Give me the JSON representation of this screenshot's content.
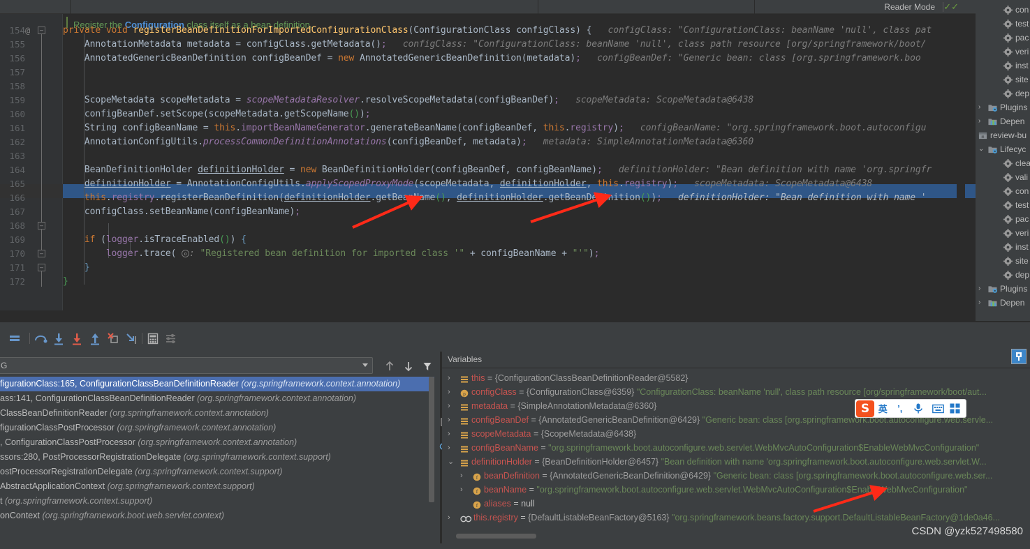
{
  "editor": {
    "reader_mode_label": "Reader Mode",
    "check_icon": "check-icon",
    "doc_comment": {
      "pre": "Register the ",
      "bold": "Configuration",
      "post": " class itself as a bean definition."
    },
    "lines": [
      {
        "num": "154",
        "gutter": "@",
        "fold": "minus"
      },
      {
        "num": "155"
      },
      {
        "num": "156"
      },
      {
        "num": "157"
      },
      {
        "num": "158"
      },
      {
        "num": "159"
      },
      {
        "num": "160"
      },
      {
        "num": "161"
      },
      {
        "num": "162"
      },
      {
        "num": "163"
      },
      {
        "num": "164"
      },
      {
        "num": "165"
      },
      {
        "num": "166"
      },
      {
        "num": "167"
      },
      {
        "num": "168",
        "fold": "minus"
      },
      {
        "num": "169"
      },
      {
        "num": "170",
        "fold": "minus"
      },
      {
        "num": "171",
        "fold": "minus"
      },
      {
        "num": "172"
      }
    ],
    "code": {
      "l154": "private void registerBeanDefinitionForImportedConfigurationClass(ConfigurationClass configClass) {",
      "l154_hint": "configClass: \"ConfigurationClass: beanName 'null', class pat",
      "l155": "AnnotationMetadata metadata = configClass.getMetadata();",
      "l155_hint": "configClass: \"ConfigurationClass: beanName 'null', class path resource [org/springframework/boot/",
      "l156": "AnnotatedGenericBeanDefinition configBeanDef = new AnnotatedGenericBeanDefinition(metadata);",
      "l156_hint": "configBeanDef: \"Generic bean: class [org.springframework.boo",
      "l158": "ScopeMetadata scopeMetadata = scopeMetadataResolver.resolveScopeMetadata(configBeanDef);",
      "l158_hint": "scopeMetadata: ScopeMetadata@6438",
      "l159": "configBeanDef.setScope(scopeMetadata.getScopeName());",
      "l160": "String configBeanName = this.importBeanNameGenerator.generateBeanName(configBeanDef, this.registry);",
      "l160_hint": "configBeanName: \"org.springframework.boot.autoconfigu",
      "l161": "AnnotationConfigUtils.processCommonDefinitionAnnotations(configBeanDef, metadata);",
      "l161_hint": "metadata: SimpleAnnotationMetadata@6360",
      "l163": "BeanDefinitionHolder definitionHolder = new BeanDefinitionHolder(configBeanDef, configBeanName);",
      "l163_hint": "definitionHolder: \"Bean definition with name 'org.springfr",
      "l164": "definitionHolder = AnnotationConfigUtils.applyScopedProxyMode(scopeMetadata, definitionHolder, this.registry);",
      "l164_hint": "scopeMetadata: ScopeMetadata@6438",
      "l165": "this.registry.registerBeanDefinition(definitionHolder.getBeanName(), definitionHolder.getBeanDefinition());",
      "l165_hint": "definitionHolder: \"Bean definition with name '",
      "l166": "configClass.setBeanName(configBeanName);",
      "l168": "if (logger.isTraceEnabled()) {",
      "l169": "logger.trace( o: \"Registered bean definition for imported class '\" + configBeanName + \"'\");",
      "l170": "}",
      "l171": "}"
    }
  },
  "maven_panel": {
    "rows": [
      {
        "label": "con",
        "icon": "gear-icon",
        "indent": 40
      },
      {
        "label": "test",
        "icon": "gear-icon",
        "indent": 40
      },
      {
        "label": "pac",
        "icon": "gear-icon",
        "indent": 40
      },
      {
        "label": "veri",
        "icon": "gear-icon",
        "indent": 40
      },
      {
        "label": "inst",
        "icon": "gear-icon",
        "indent": 40
      },
      {
        "label": "site",
        "icon": "gear-icon",
        "indent": 40
      },
      {
        "label": "dep",
        "icon": "gear-icon",
        "indent": 40
      },
      {
        "label": "Plugins",
        "icon": "folder-plugins-icon",
        "indent": 18,
        "arrow": "collapsed"
      },
      {
        "label": "Depen",
        "icon": "folder-deps-icon",
        "indent": 18,
        "arrow": "collapsed"
      },
      {
        "label": "review-bu",
        "icon": "maven-module-icon",
        "indent": 4,
        "arrow": "expanded"
      },
      {
        "label": "Lifecyc",
        "icon": "folder-plugins-icon",
        "indent": 18,
        "arrow": "expanded"
      },
      {
        "label": "clea",
        "icon": "gear-icon",
        "indent": 40
      },
      {
        "label": "vali",
        "icon": "gear-icon",
        "indent": 40
      },
      {
        "label": "con",
        "icon": "gear-icon",
        "indent": 40
      },
      {
        "label": "test",
        "icon": "gear-icon",
        "indent": 40
      },
      {
        "label": "pac",
        "icon": "gear-icon",
        "indent": 40
      },
      {
        "label": "veri",
        "icon": "gear-icon",
        "indent": 40
      },
      {
        "label": "inst",
        "icon": "gear-icon",
        "indent": 40
      },
      {
        "label": "site",
        "icon": "gear-icon",
        "indent": 40
      },
      {
        "label": "dep",
        "icon": "gear-icon",
        "indent": 40
      },
      {
        "label": "Plugins",
        "icon": "folder-plugins-icon",
        "indent": 18,
        "arrow": "collapsed"
      },
      {
        "label": "Depen",
        "icon": "folder-deps-icon",
        "indent": 18,
        "arrow": "collapsed"
      }
    ]
  },
  "debugger": {
    "toolbar_icons": [
      "show-execution-point-icon",
      "step-over-icon",
      "step-into-icon",
      "force-step-into-icon",
      "step-out-icon",
      "drop-frame-icon",
      "run-to-cursor-icon",
      "evaluate-expression-icon",
      "settings-icon"
    ],
    "frames": {
      "combo_value": "G",
      "up_icon": "arrow-up-icon",
      "down_icon": "arrow-down-icon",
      "filter_icon": "filter-icon",
      "items": [
        {
          "main": "figurationClass:165, ConfigurationClassBeanDefinitionReader",
          "pkg": "(org.springframework.context.annotation)",
          "selected": true
        },
        {
          "main": "ass:141, ConfigurationClassBeanDefinitionReader",
          "pkg": "(org.springframework.context.annotation)",
          "selected": false
        },
        {
          "main": "ClassBeanDefinitionReader",
          "pkg": "(org.springframework.context.annotation)",
          "selected": false
        },
        {
          "main": "figurationClassPostProcessor",
          "pkg": "(org.springframework.context.annotation)",
          "selected": false
        },
        {
          "main": ", ConfigurationClassPostProcessor",
          "pkg": "(org.springframework.context.annotation)",
          "selected": false
        },
        {
          "main": "ssors:280, PostProcessorRegistrationDelegate",
          "pkg": "(org.springframework.context.support)",
          "selected": false
        },
        {
          "main": "ostProcessorRegistrationDelegate",
          "pkg": "(org.springframework.context.support)",
          "selected": false
        },
        {
          "main": "AbstractApplicationContext",
          "pkg": "(org.springframework.context.support)",
          "selected": false
        },
        {
          "main": "t",
          "pkg": "(org.springframework.context.support)",
          "selected": false
        },
        {
          "main": "onContext",
          "pkg": "(org.springframework.boot.web.servlet.context)",
          "selected": false
        }
      ],
      "add_button": "+",
      "remove_button": "−",
      "copy_button": "copy-icon",
      "link_button": "link-icon"
    },
    "variables": {
      "title": "Variables",
      "rows": [
        {
          "indent": 0,
          "arrow": "collapsed",
          "icon": "field-group-icon",
          "name": "this",
          "eq": " = ",
          "obj": "{ConfigurationClassBeanDefinitionReader@5582}",
          "str": ""
        },
        {
          "indent": 0,
          "arrow": "collapsed",
          "icon": "parameter-icon",
          "name": "configClass",
          "eq": " = ",
          "obj": "{ConfigurationClass@6359}",
          "str": "\"ConfigurationClass: beanName 'null', class path resource [org/springframework/boot/aut..."
        },
        {
          "indent": 0,
          "arrow": "collapsed",
          "icon": "field-group-icon",
          "name": "metadata",
          "eq": " = ",
          "obj": "{SimpleAnnotationMetadata@6360}",
          "str": ""
        },
        {
          "indent": 0,
          "arrow": "collapsed",
          "icon": "field-group-icon",
          "name": "configBeanDef",
          "eq": " = ",
          "obj": "{AnnotatedGenericBeanDefinition@6429}",
          "str": "\"Generic bean: class [org.springframework.boot.autoconfigure.web.servle..."
        },
        {
          "indent": 0,
          "arrow": "collapsed",
          "icon": "field-group-icon",
          "name": "scopeMetadata",
          "eq": " = ",
          "obj": "{ScopeMetadata@6438}",
          "str": ""
        },
        {
          "indent": 0,
          "arrow": "collapsed",
          "icon": "field-group-icon",
          "name": "configBeanName",
          "eq": " = ",
          "obj": "",
          "str": "\"org.springframework.boot.autoconfigure.web.servlet.WebMvcAutoConfiguration$EnableWebMvcConfiguration\""
        },
        {
          "indent": 0,
          "arrow": "expanded",
          "icon": "field-group-icon",
          "name": "definitionHolder",
          "eq": " = ",
          "obj": "{BeanDefinitionHolder@6457}",
          "str": "\"Bean definition with name 'org.springframework.boot.autoconfigure.web.servlet.W..."
        },
        {
          "indent": 1,
          "arrow": "collapsed",
          "icon": "field-icon",
          "name": "beanDefinition",
          "eq": " = ",
          "obj": "{AnnotatedGenericBeanDefinition@6429}",
          "str": "\"Generic bean: class [org.springframework.boot.autoconfigure.web.ser..."
        },
        {
          "indent": 1,
          "arrow": "collapsed",
          "icon": "field-icon",
          "name": "beanName",
          "eq": " = ",
          "obj": "",
          "str": "\"org.springframework.boot.autoconfigure.web.servlet.WebMvcAutoConfiguration$EnableWebMvcConfiguration\""
        },
        {
          "indent": 1,
          "arrow": "none",
          "icon": "field-icon",
          "name": "aliases",
          "eq": " = ",
          "obj": "",
          "str": "",
          "nullval": "null"
        },
        {
          "indent": 0,
          "arrow": "collapsed",
          "icon": "watch-icon",
          "name": "this.registry",
          "eq": " = ",
          "obj": "{DefaultListableBeanFactory@5163}",
          "str": "\"org.springframework.beans.factory.support.DefaultListableBeanFactory@1de0a46..."
        }
      ]
    }
  },
  "ime_toolbar": {
    "logo": "S",
    "items": [
      "英",
      "’,",
      "mic-icon",
      "keyboard-icon",
      "apps-icon"
    ]
  },
  "watermark": "CSDN @yzk527498580",
  "colors": {
    "editor_bg": "#2b2b2b",
    "panel_bg": "#3c3f41",
    "selection": "#2f5687",
    "stack_selection": "#4b6eaf",
    "keyword": "#cc7832",
    "string": "#6a8759",
    "field": "#9876aa",
    "comment": "#629755",
    "arrow_red": "#ff2a18",
    "accent_blue": "#3d86c8"
  }
}
